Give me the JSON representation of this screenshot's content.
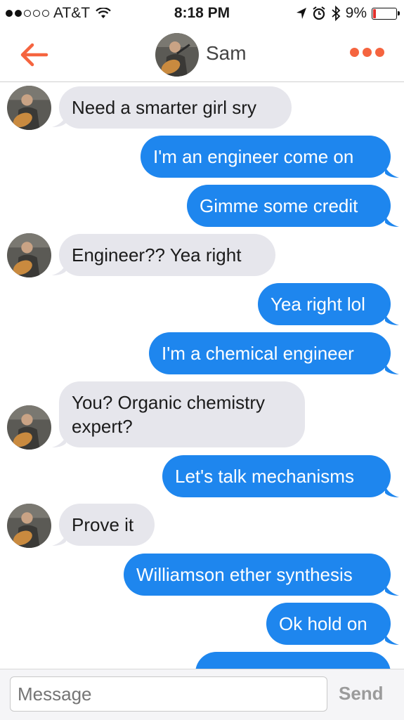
{
  "status_bar": {
    "carrier": "AT&T",
    "time": "8:18 PM",
    "battery": "9%"
  },
  "header": {
    "contact_name": "Sam",
    "back_icon": "arrow-left-icon",
    "more_icon": "more-horizontal-icon",
    "accent": "#f5643f"
  },
  "messages": [
    {
      "from": "Sam",
      "text": "Need a smarter girl sry"
    },
    {
      "from": "me",
      "text": "I'm an engineer come on"
    },
    {
      "from": "me",
      "text": "Gimme some credit"
    },
    {
      "from": "Sam",
      "text": "Engineer?? Yea right"
    },
    {
      "from": "me",
      "text": "Yea right lol"
    },
    {
      "from": "me",
      "text": "I'm a chemical engineer"
    },
    {
      "from": "Sam",
      "text": "You? Organic chemistry\nexpert?"
    },
    {
      "from": "me",
      "text": "Let's talk mechanisms"
    },
    {
      "from": "Sam",
      "text": "Prove it"
    },
    {
      "from": "me",
      "text": "Williamson ether synthesis"
    },
    {
      "from": "me",
      "text": "Ok hold on"
    }
  ],
  "composer": {
    "placeholder": "Message",
    "send_label": "Send"
  },
  "colors": {
    "outgoing": "#1e86ee",
    "incoming": "#e6e6ec"
  }
}
